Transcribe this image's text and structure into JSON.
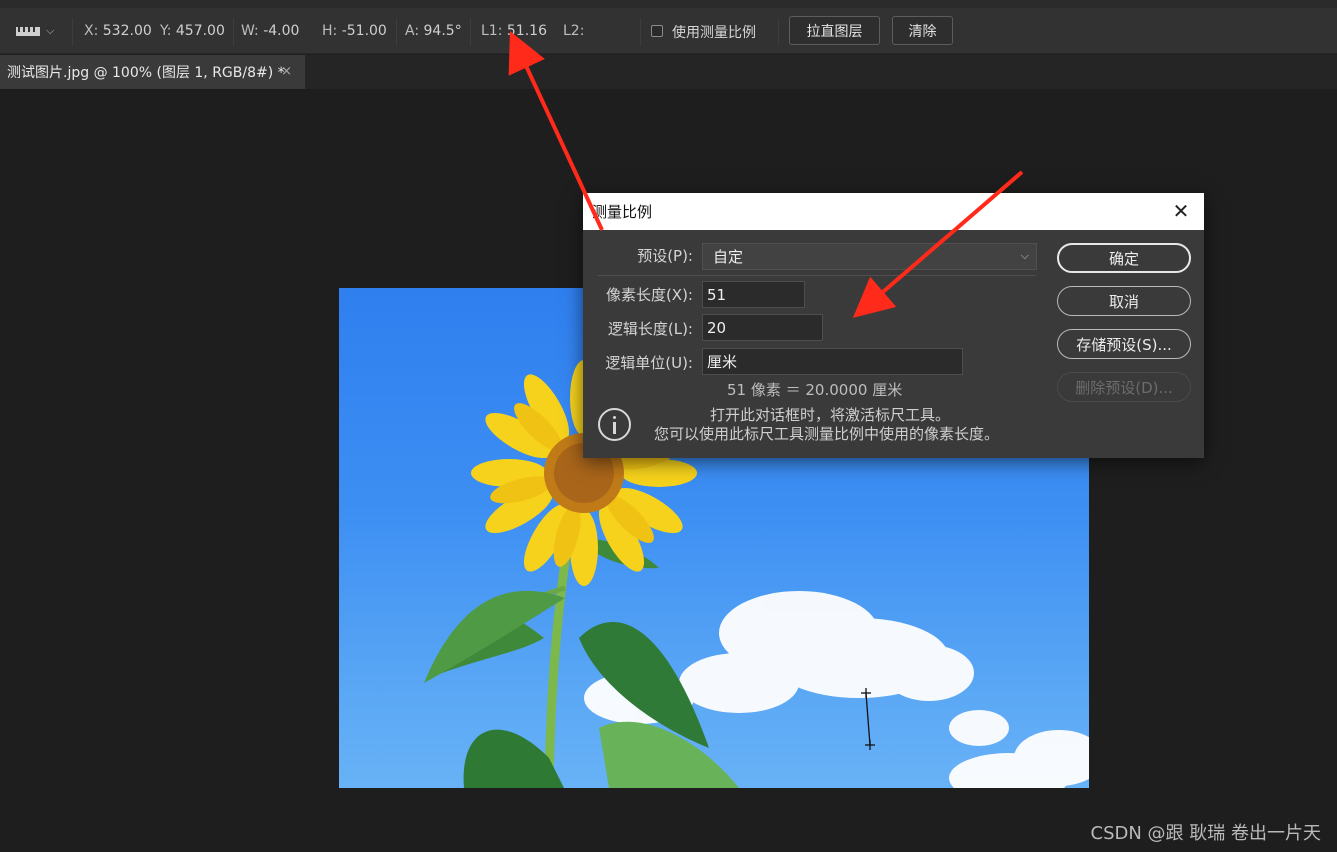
{
  "options_bar": {
    "tool_icon": "ruler-icon",
    "x_label": "X:",
    "x_value": "532.00",
    "y_label": "Y:",
    "y_value": "457.00",
    "w_label": "W:",
    "w_value": "-4.00",
    "h_label": "H:",
    "h_value": "-51.00",
    "a_label": "A:",
    "a_value": "94.5°",
    "l1_label": "L1:",
    "l1_value": "51.16",
    "l2_label": "L2:",
    "use_scale_label": "使用测量比例",
    "straighten_label": "拉直图层",
    "clear_label": "清除"
  },
  "document_tab": {
    "title": "测试图片.jpg @ 100% (图层 1, RGB/8#) *",
    "close_icon": "×"
  },
  "dialog": {
    "title": "测量比例",
    "preset_label": "预设(P):",
    "preset_value": "自定",
    "pixel_length_label": "像素长度(X):",
    "pixel_length_value": "51",
    "logical_length_label": "逻辑长度(L):",
    "logical_length_value": "20",
    "logical_units_label": "逻辑单位(U):",
    "logical_units_value": "厘米",
    "conversion_text": "51 像素 ＝ 20.0000 厘米",
    "info_line1": "打开此对话框时，将激活标尺工具。",
    "info_line2": "您可以使用此标尺工具测量比例中使用的像素长度。",
    "ok_label": "确定",
    "cancel_label": "取消",
    "save_preset_label": "存储预设(S)...",
    "delete_preset_label": "删除预设(D)..."
  },
  "watermark": "CSDN @跟 耿瑞 卷出一片天",
  "colors": {
    "annotation_arrow": "#ff2a1a",
    "sky": "#3d8ff3"
  }
}
